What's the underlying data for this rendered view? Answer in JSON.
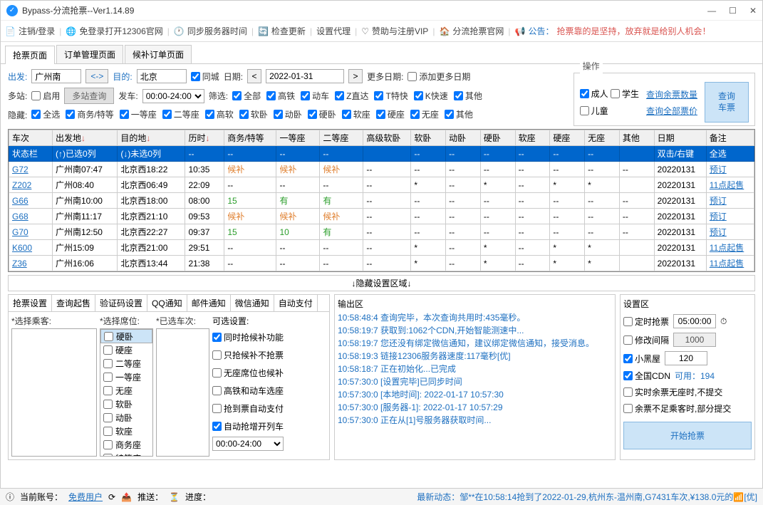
{
  "window": {
    "title": "Bypass-分流抢票--Ver1.14.89"
  },
  "toolbar": {
    "logout": "注销/登录",
    "open12306": "免登录打开12306官网",
    "syncTime": "同步服务器时间",
    "checkUpdate": "检查更新",
    "proxy": "设置代理",
    "donate": "赞助与注册VIP",
    "official": "分流抢票官网",
    "announceLabel": "公告：",
    "announceText": "抢票靠的是坚持，放弃就是给别人机会！"
  },
  "mainTabs": [
    "抢票页面",
    "订单管理页面",
    "候补订单页面"
  ],
  "search": {
    "fromLabel": "出发:",
    "fromValue": "广州南",
    "swap": "<->",
    "toLabel": "目的:",
    "toValue": "北京",
    "sameCity": "同城",
    "dateLabel": "日期:",
    "dateValue": "2022-01-31",
    "moreDateLabel": "更多日期:",
    "addMoreDate": "添加更多日期",
    "multiLabel": "多站:",
    "enable": "启用",
    "multiQuery": "多站查询",
    "departLabel": "发车:",
    "departValue": "00:00-24:00",
    "filterLabel": "筛选:",
    "filters": [
      "全部",
      "高铁",
      "动车",
      "Z直达",
      "T特快",
      "K快速",
      "其他"
    ],
    "hideLabel": "隐藏:",
    "hides": [
      "全选",
      "商务/特等",
      "一等座",
      "二等座",
      "高软",
      "软卧",
      "动卧",
      "硬卧",
      "软座",
      "硬座",
      "无座",
      "其他"
    ]
  },
  "ops": {
    "title": "操作",
    "adult": "成人",
    "student": "学生",
    "child": "儿童",
    "queryRemain": "查询余票数量",
    "queryAllPrice": "查询全部票价",
    "queryBtn": "查询\n车票"
  },
  "tableHeaders": [
    "车次",
    "出发地↓",
    "目的地↓",
    "历时↓",
    "商务/特等",
    "一等座",
    "二等座",
    "高级软卧",
    "软卧",
    "动卧",
    "硬卧",
    "软座",
    "硬座",
    "无座",
    "其他",
    "日期",
    "备注"
  ],
  "statusRow": [
    "状态栏",
    "(↑)已选0列",
    "(↓)未选0列",
    "--",
    "--",
    "--",
    "--",
    "",
    "--",
    "--",
    "--",
    "--",
    "--",
    "--",
    "",
    "双击/右键",
    "全选"
  ],
  "rows": [
    {
      "train": "G72",
      "from": "广州南07:47",
      "to": "北京西18:22",
      "dur": "10:35",
      "cells": [
        "候补",
        "候补",
        "候补",
        "--",
        "--",
        "--",
        "--",
        "--",
        "--",
        "--",
        "--"
      ],
      "date": "20220131",
      "remark": "预订",
      "cls": [
        "orange",
        "orange",
        "orange",
        "",
        "",
        "",
        "",
        "",
        "",
        "",
        ""
      ]
    },
    {
      "train": "Z202",
      "from": "广州08:40",
      "to": "北京西06:49",
      "dur": "22:09",
      "cells": [
        "--",
        "--",
        "--",
        "--",
        "*",
        "--",
        "*",
        "--",
        "*",
        "*",
        ""
      ],
      "date": "20220131",
      "remark": "11点起售",
      "cls": [
        "",
        "",
        "",
        "",
        "",
        "",
        "",
        "",
        "",
        "",
        ""
      ]
    },
    {
      "train": "G66",
      "from": "广州南10:00",
      "to": "北京西18:00",
      "dur": "08:00",
      "cells": [
        "15",
        "有",
        "有",
        "--",
        "--",
        "--",
        "--",
        "--",
        "--",
        "--",
        "--"
      ],
      "date": "20220131",
      "remark": "预订",
      "cls": [
        "green",
        "green",
        "green",
        "",
        "",
        "",
        "",
        "",
        "",
        "",
        ""
      ]
    },
    {
      "train": "G68",
      "from": "广州南11:17",
      "to": "北京西21:10",
      "dur": "09:53",
      "cells": [
        "候补",
        "候补",
        "候补",
        "--",
        "--",
        "--",
        "--",
        "--",
        "--",
        "--",
        "--"
      ],
      "date": "20220131",
      "remark": "预订",
      "cls": [
        "orange",
        "orange",
        "orange",
        "",
        "",
        "",
        "",
        "",
        "",
        "",
        ""
      ]
    },
    {
      "train": "G70",
      "from": "广州南12:50",
      "to": "北京西22:27",
      "dur": "09:37",
      "cells": [
        "15",
        "10",
        "有",
        "--",
        "--",
        "--",
        "--",
        "--",
        "--",
        "--",
        "--"
      ],
      "date": "20220131",
      "remark": "预订",
      "cls": [
        "green",
        "green",
        "green",
        "",
        "",
        "",
        "",
        "",
        "",
        "",
        ""
      ]
    },
    {
      "train": "K600",
      "from": "广州15:09",
      "to": "北京西21:00",
      "dur": "29:51",
      "cells": [
        "--",
        "--",
        "--",
        "--",
        "*",
        "--",
        "*",
        "--",
        "*",
        "*",
        ""
      ],
      "date": "20220131",
      "remark": "11点起售",
      "cls": [
        "",
        "",
        "",
        "",
        "",
        "",
        "",
        "",
        "",
        "",
        ""
      ]
    },
    {
      "train": "Z36",
      "from": "广州16:06",
      "to": "北京西13:44",
      "dur": "21:38",
      "cells": [
        "--",
        "--",
        "--",
        "--",
        "*",
        "--",
        "*",
        "--",
        "*",
        "*",
        ""
      ],
      "date": "20220131",
      "remark": "11点起售",
      "cls": [
        "",
        "",
        "",
        "",
        "",
        "",
        "",
        "",
        "",
        "",
        ""
      ]
    }
  ],
  "hideRegion": "↓隐藏设置区域↓",
  "subTabs": [
    "抢票设置",
    "查询起售",
    "验证码设置",
    "QQ通知",
    "邮件通知",
    "微信通知",
    "自动支付"
  ],
  "passengerLabel": "*选择乘客:",
  "seatLabel": "*选择席位:",
  "seatList": [
    "硬卧",
    "硬座",
    "二等座",
    "一等座",
    "无座",
    "软卧",
    "动卧",
    "软座",
    "商务座",
    "特等座"
  ],
  "trainSelLabel": "*已选车次:",
  "optLabel": "可选设置:",
  "opts": [
    "同时抢候补功能",
    "只抢候补不抢票",
    "无座席位也候补",
    "高铁和动车选座",
    "抢到票自动支付",
    "自动抢增开列车"
  ],
  "optTime": "00:00-24:00",
  "logLabel": "输出区",
  "logs": [
    "10:58:48:4  查询完毕，本次查询共用时:435毫秒。",
    "10:58:19:7  获取到:1062个CDN,开始智能测速中...",
    "10:58:19:7  您还没有绑定微信通知，建议绑定微信通知，接受消息。",
    "10:58:19:3  链接12306服务器速度:117毫秒[优]",
    "10:58:18:7  正在初始化...已完成",
    "10:57:30:0  [设置完毕]已同步时间",
    "10:57:30:0  [本地时间]: 2022-01-17 10:57:30",
    "10:57:30:0  [服务器-1]:  2022-01-17 10:57:29",
    "10:57:30:0  正在从[1]号服务器获取时间..."
  ],
  "setLabel": "设置区",
  "settings": {
    "timer": "定时抢票",
    "timerVal": "05:00:00",
    "interval": "修改间隔",
    "intervalVal": "1000",
    "blackroom": "小黑屋",
    "blackroomVal": "120",
    "cdn": "全国CDN",
    "cdnText": "可用：194",
    "realtime": "实时余票无座时,不提交",
    "partial": "余票不足乘客时,部分提交",
    "start": "开始抢票"
  },
  "status": {
    "account": "当前账号：",
    "userType": "免费用户",
    "recommend": "推送：",
    "progress": "进度：",
    "newsLabel": "最新动态：",
    "newsText": "邹**在10:58:14抢到了2022-01-29,杭州东-温州南,G7431车次,¥138.0元的",
    "tail": "[优]"
  }
}
